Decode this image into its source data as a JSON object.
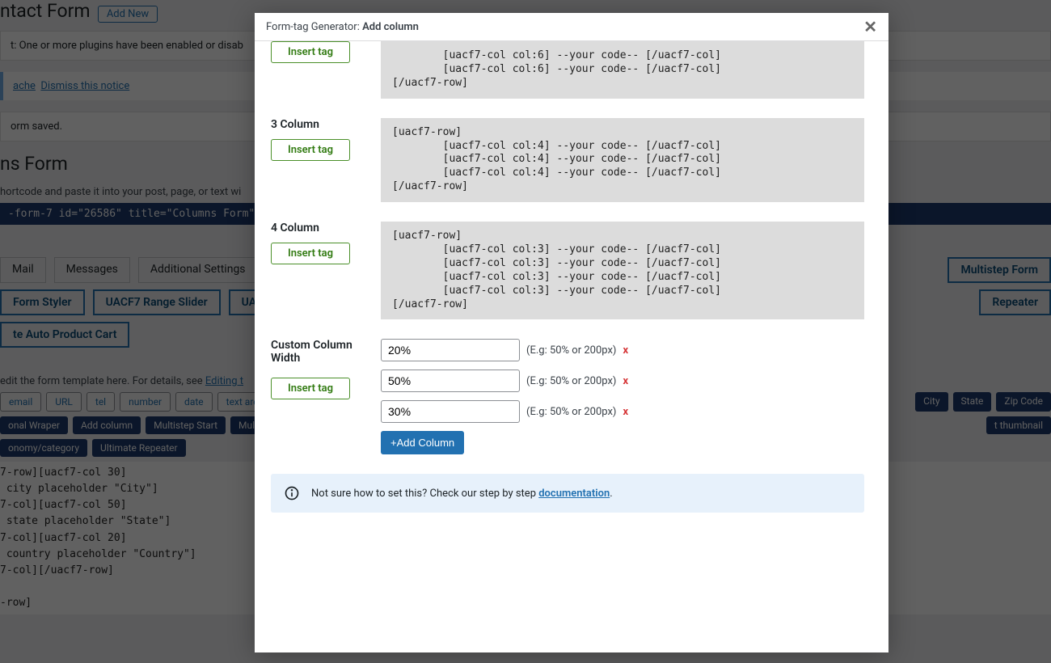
{
  "bg": {
    "page_title": "ntact Form",
    "add_new": "Add New",
    "notice_plugins": "t: One or more plugins have been enabled or disab",
    "notice_cache": "ache",
    "notice_dismiss": "Dismiss this notice",
    "notice_saved": "orm saved.",
    "form_title": "ns Form",
    "shortcode_desc": "hortcode and paste it into your post, page, or text wi",
    "shortcode": "-form-7 id=\"26586\" title=\"Columns Form\"]",
    "tabs": [
      "Mail",
      "Messages",
      "Additional Settings"
    ],
    "tabs_right": [
      "Multistep Form"
    ],
    "tabs_blue_row2_left": [
      "Form Styler",
      "UACF7 Range Slider",
      "UAC"
    ],
    "tabs_blue_row2_right": [
      "Repeater"
    ],
    "tabs_blue_row3": [
      "te Auto Product Cart"
    ],
    "edit_desc": "edit the form template here. For details, see ",
    "edit_link": "Editing t",
    "pills_row1_left": [
      "email",
      "URL",
      "tel",
      "number",
      "date",
      "text area"
    ],
    "pills_row1_right": [
      "City",
      "State",
      "Zip Code"
    ],
    "pills_row2_left": [
      "onal Wraper",
      "Add column",
      "Multistep Start",
      "Multis"
    ],
    "pills_row2_right": [
      "t thumbnail"
    ],
    "pills_row3": [
      "onomy/category",
      "Ultimate Repeater"
    ],
    "code": "7-row][uacf7-col 30]\n city placeholder \"City\"]\n7-col][uacf7-col 50]\n state placeholder \"State\"]\n7-col][uacf7-col 20]\n country placeholder \"Country\"]\n7-col][/uacf7-row]\n\n-row]"
  },
  "modal": {
    "title_prefix": "Form-tag Generator: ",
    "title_name": "Add column",
    "sections": [
      {
        "label": "",
        "insert": "Insert tag",
        "code": "        [uacf7-col col:6] --your code-- [/uacf7-col]\n        [uacf7-col col:6] --your code-- [/uacf7-col]\n[/uacf7-row]"
      },
      {
        "label": "3 Column",
        "insert": "Insert tag",
        "code": "[uacf7-row]\n        [uacf7-col col:4] --your code-- [/uacf7-col]\n        [uacf7-col col:4] --your code-- [/uacf7-col]\n        [uacf7-col col:4] --your code-- [/uacf7-col]\n[/uacf7-row]"
      },
      {
        "label": "4 Column",
        "insert": "Insert tag",
        "code": "[uacf7-row]\n        [uacf7-col col:3] --your code-- [/uacf7-col]\n        [uacf7-col col:3] --your code-- [/uacf7-col]\n        [uacf7-col col:3] --your code-- [/uacf7-col]\n        [uacf7-col col:3] --your code-- [/uacf7-col]\n[/uacf7-row]"
      }
    ],
    "custom": {
      "label": "Custom Column Width",
      "insert": "Insert tag",
      "rows": [
        {
          "value": "20%",
          "hint": "(E.g: 50% or 200px)",
          "del": "x"
        },
        {
          "value": "50%",
          "hint": "(E.g: 50% or 200px)",
          "del": "x"
        },
        {
          "value": "30%",
          "hint": "(E.g: 50% or 200px)",
          "del": "x"
        }
      ],
      "add": "+Add Column"
    },
    "doc_text_pre": "Not sure how to set this? Check our step by step ",
    "doc_link": "documentation",
    "doc_text_post": "."
  }
}
